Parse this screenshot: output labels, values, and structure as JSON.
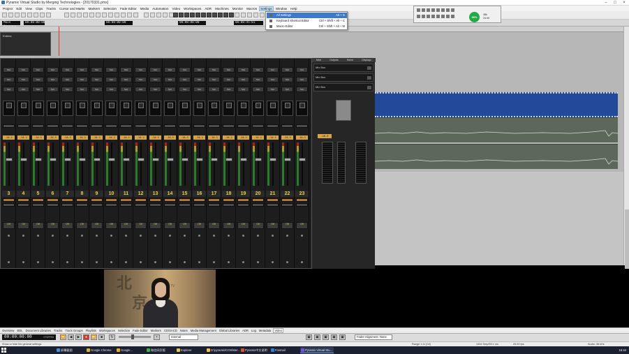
{
  "window": {
    "title": "Pyramix Virtual Studio by Merging Technologies - [20170331.pmx]"
  },
  "menubar": {
    "items": [
      "Project",
      "Edit",
      "View",
      "Clips",
      "Tracks",
      "Cursor and Marks",
      "Markers",
      "Selection",
      "Fade Editor",
      "Media",
      "Automation",
      "Video",
      "Workspaces",
      "ADR",
      "Machines",
      "Monitor",
      "Macros",
      "Settings",
      "Window",
      "Help"
    ],
    "active": "Settings"
  },
  "settings_menu": {
    "items": [
      {
        "label": "All Settings",
        "shortcut": "Alt + G"
      },
      {
        "label": "Keyboard Shortcut Editor",
        "shortcut": "Ctrl + Shift + Alt + C"
      },
      {
        "label": "Macro Editor",
        "shortcut": "Ctrl + Shift + Alt + M"
      }
    ]
  },
  "timecodes": {
    "main": "Main  Pinnace",
    "main_tc": "00:00:00:00",
    "in_tc": "00:00:00:00",
    "out_tc": "00:00:00:00",
    "dur_tc": "00:00:45:01"
  },
  "status": {
    "cpu": "36%",
    "rate": "48k",
    "bits": "24 bit"
  },
  "track_panel": {
    "header": "Entries"
  },
  "mixer": {
    "strips": [
      {
        "num": "3",
        "vol": "-14.1"
      },
      {
        "num": "4",
        "vol": "-14.1"
      },
      {
        "num": "5",
        "vol": "-14.1"
      },
      {
        "num": "6",
        "vol": "-14.1"
      },
      {
        "num": "7",
        "vol": "-14.1"
      },
      {
        "num": "8",
        "vol": "-14.1"
      },
      {
        "num": "9",
        "vol": "-14.1"
      },
      {
        "num": "10",
        "vol": "-14.1"
      },
      {
        "num": "11",
        "vol": "-14.1"
      },
      {
        "num": "12",
        "vol": "-14.1"
      },
      {
        "num": "13",
        "vol": "-14.1"
      },
      {
        "num": "14",
        "vol": "-14.1"
      },
      {
        "num": "15",
        "vol": "-14.1"
      },
      {
        "num": "16",
        "vol": "-14.1"
      },
      {
        "num": "17",
        "vol": "-14.1"
      },
      {
        "num": "18",
        "vol": "-14.1"
      },
      {
        "num": "19",
        "vol": "-14.1"
      },
      {
        "num": "20",
        "vol": "-14.1"
      },
      {
        "num": "21",
        "vol": "-14.1"
      },
      {
        "num": "22",
        "vol": "-14.1"
      },
      {
        "num": "23",
        "vol": "-14.1"
      }
    ],
    "slot_label": "Slot",
    "auto_label": "Off"
  },
  "master": {
    "tabs": [
      "Mstr",
      "Outputs",
      "Home",
      "Displays"
    ],
    "buses": [
      "Mix Bus",
      "Mix Bus",
      "Mix Bus"
    ],
    "vol": "-16.3"
  },
  "video": {
    "chars": [
      "北",
      "京"
    ],
    "channel": "TV"
  },
  "tabs": [
    "Overview",
    "EDL",
    "Document Libraries",
    "Tracks",
    "Track Groups",
    "Playlists",
    "Workspaces",
    "Selection",
    "Fade Editor",
    "Markers",
    "CD/SACD",
    "Notes",
    "Media Management",
    "Global Libraries",
    "ADR",
    "Log",
    "Metadata",
    "Video"
  ],
  "active_tab": "Video",
  "transport": {
    "time": "00:00:00:00",
    "state": "STOPPED",
    "sync": "Internal",
    "fader_alignment": "Fader Alignment: None"
  },
  "statusbar": {
    "hint": "Show or hide the general settings",
    "range": "Range   1:11 [04]",
    "length": "1404 Smp/59.1 ms",
    "fps": "25.00 fps",
    "audio": "Audio: 48 kHz"
  },
  "taskbar": {
    "items": [
      "屏幕截图",
      "Google Chrome",
      "Google...",
      "微信网页版",
      "Explorer",
      "D:\\pyramix\\COS\\Mer...",
      "Pyramix中文说明",
      "Foxmail",
      "Pyramix Virtual Stu..."
    ],
    "time": "16:44"
  },
  "colors": {
    "clip_blue": "#23499a",
    "wave_track": "#5c685a",
    "strip_num": "#e8d24a",
    "vol_readout": "#d4a34a",
    "cpu_green": "#22a844"
  }
}
